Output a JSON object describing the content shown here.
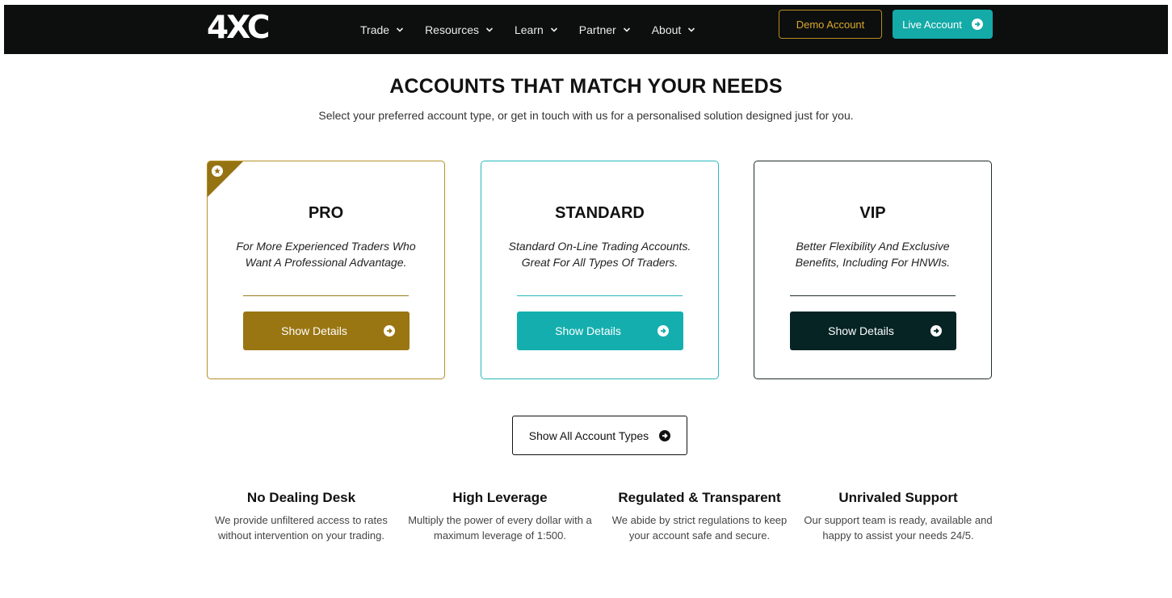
{
  "header": {
    "logo_text": "4XC",
    "nav": [
      {
        "label": "Trade",
        "icon": "chevron-down-icon"
      },
      {
        "label": "Resources",
        "icon": "chevron-down-icon"
      },
      {
        "label": "Learn",
        "icon": "chevron-down-icon"
      },
      {
        "label": "Partner",
        "icon": "chevron-down-icon"
      },
      {
        "label": "About",
        "icon": "chevron-down-icon"
      }
    ],
    "demo_button": "Demo Account",
    "live_button": "Live Account"
  },
  "hero": {
    "title": "ACCOUNTS THAT MATCH YOUR NEEDS",
    "subtitle": "Select your preferred account type, or get in touch with us for a personalised solution designed just for you."
  },
  "cards": [
    {
      "title": "PRO",
      "description": "For More Experienced Traders Who Want A Professional Advantage.",
      "button": "Show Details",
      "accent": "#9a7612",
      "badge_icon": "star-icon"
    },
    {
      "title": "STANDARD",
      "description": "Standard On-Line Trading Accounts. Great For All Types Of Traders.",
      "button": "Show Details",
      "accent": "#15aeae"
    },
    {
      "title": "VIP",
      "description": "Better Flexibility And Exclusive Benefits, Including For HNWIs.",
      "button": "Show Details",
      "accent": "#062424"
    }
  ],
  "show_all_button": "Show All Account Types",
  "features": [
    {
      "title": "No Dealing Desk",
      "text": "We provide unfiltered access to rates without intervention on your trading."
    },
    {
      "title": "High Leverage",
      "text": "Multiply the power of every dollar with a maximum leverage of 1:500."
    },
    {
      "title": "Regulated & Transparent",
      "text": "We abide by strict regulations to keep your account safe and secure."
    },
    {
      "title": "Unrivaled Support",
      "text": "Our support team is ready, available and happy to assist your needs 24/5."
    }
  ],
  "colors": {
    "header_bg": "#0d0f0f",
    "gold": "#9a7612",
    "teal": "#15aeae",
    "dark": "#062424"
  }
}
